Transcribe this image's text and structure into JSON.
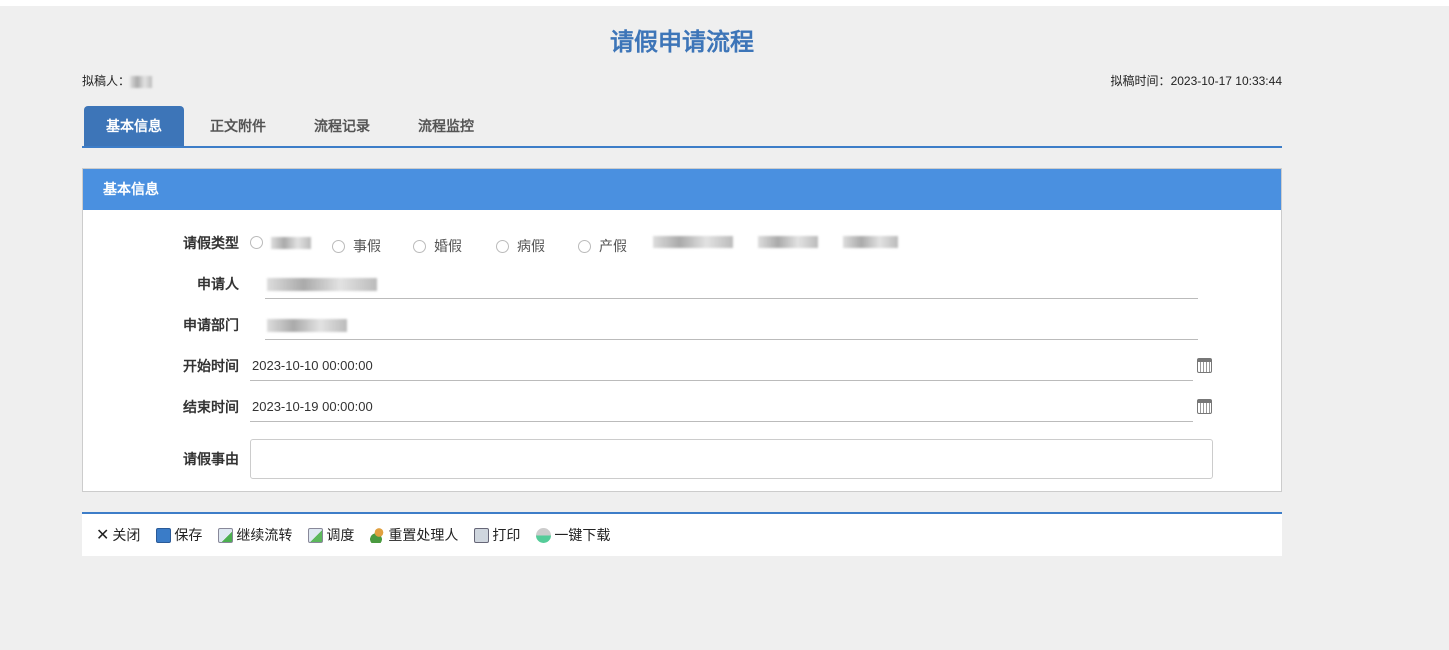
{
  "title": "请假申请流程",
  "drafter_label": "拟稿人：",
  "draft_time_label": "拟稿时间：",
  "draft_time": "2023-10-17 10:33:44",
  "tabs": [
    "基本信息",
    "正文附件",
    "流程记录",
    "流程监控"
  ],
  "panel_title": "基本信息",
  "form": {
    "leave_type_label": "请假类型",
    "leave_types": [
      "事假",
      "婚假",
      "病假",
      "产假"
    ],
    "applicant_label": "申请人",
    "department_label": "申请部门",
    "start_label": "开始时间",
    "start_value": "2023-10-10 00:00:00",
    "end_label": "结束时间",
    "end_value": "2023-10-19 00:00:00",
    "reason_label": "请假事由",
    "reason_value": ""
  },
  "toolbar": [
    "关闭",
    "保存",
    "继续流转",
    "调度",
    "重置处理人",
    "打印",
    "一键下载"
  ],
  "colors": {
    "accent": "#3d75b8",
    "panel_header": "#4a90e0"
  }
}
